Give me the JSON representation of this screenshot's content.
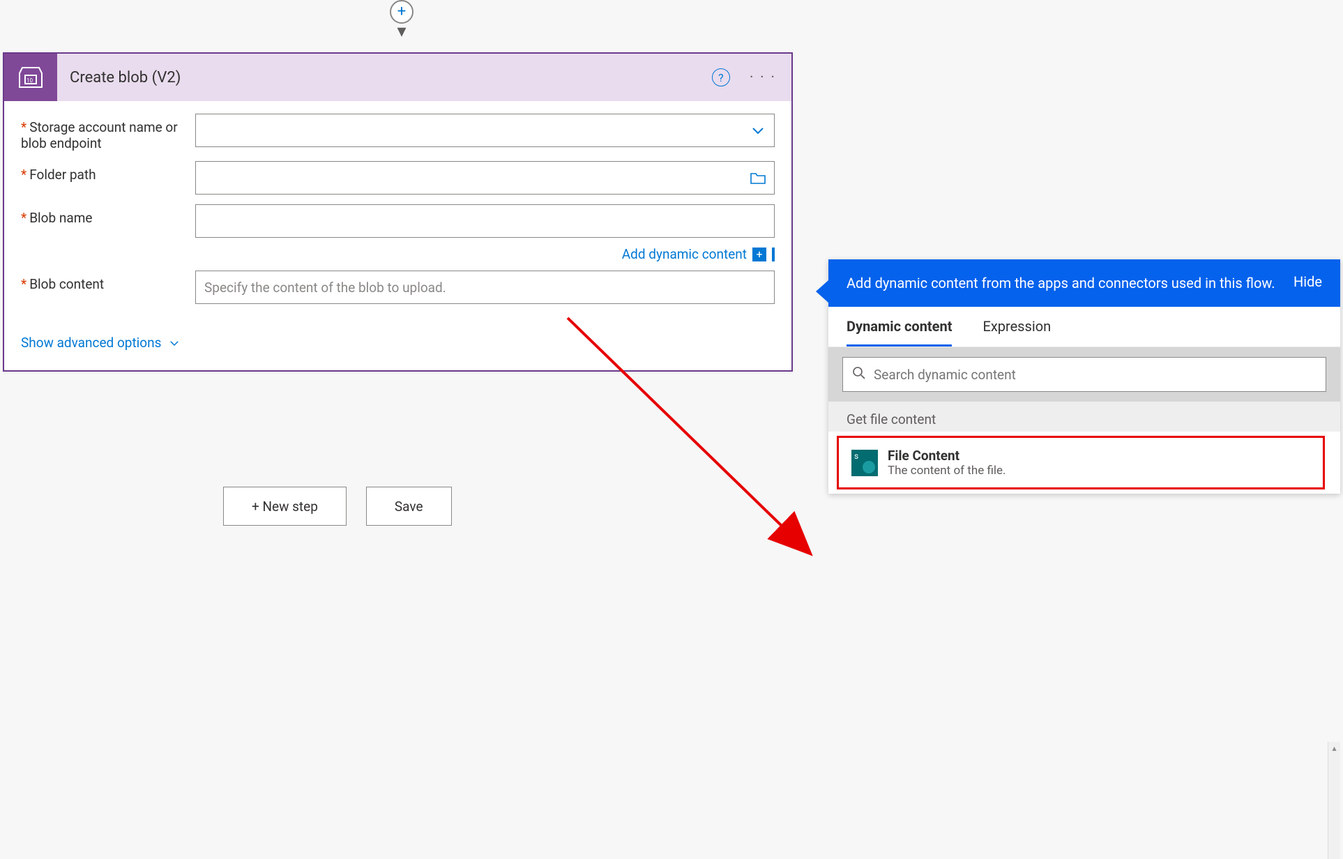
{
  "card": {
    "title": "Create blob (V2)",
    "fields": {
      "storage_label": "Storage account name or blob endpoint",
      "folder_label": "Folder path",
      "blobname_label": "Blob name",
      "blobcontent_label": "Blob content",
      "blobcontent_placeholder": "Specify the content of the blob to upload."
    },
    "add_dynamic_label": "Add dynamic content",
    "advanced_label": "Show advanced options"
  },
  "buttons": {
    "new_step": "+ New step",
    "save": "Save"
  },
  "dynamic_panel": {
    "header_text": "Add dynamic content from the apps and connectors used in this flow.",
    "hide_label": "Hide",
    "tabs": {
      "dynamic": "Dynamic content",
      "expression": "Expression"
    },
    "search_placeholder": "Search dynamic content",
    "section_header": "Get file content",
    "item": {
      "title": "File Content",
      "subtitle": "The content of the file."
    }
  }
}
